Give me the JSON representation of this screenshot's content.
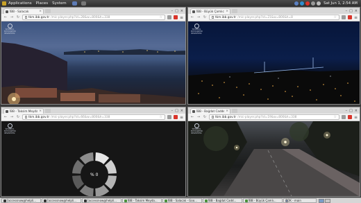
{
  "top_panel": {
    "menus": [
      "Applications",
      "Places",
      "System"
    ],
    "clock": "Sat Jun  1,  2:54 AM"
  },
  "windows": [
    {
      "tab_title": "İBB - Salacak",
      "url_host": "tkm.ibb.gov.tr",
      "url_path": "/mic-player.php?id=28&w=800&h=338"
    },
    {
      "tab_title": "İBB - Büyük Çamlıca",
      "url_host": "tkm.ibb.gov.tr",
      "url_path": "/mic-player.php?id=21&w=800&h=8"
    },
    {
      "tab_title": "İBB - Taksim Meydan...",
      "url_host": "tkm.ibb.gov.tr",
      "url_path": "/mic-player.php?id=66&w=800&h=338",
      "loading_text": "% 0",
      "loading_progress": 0
    },
    {
      "tab_title": "İBB - Bağdat Caddesi",
      "url_host": "tkm.ibb.gov.tr",
      "url_path": "/mic-player.php?id=19&w=800&h=338"
    }
  ],
  "logo_text": [
    "İSTANBUL",
    "BÜYÜKŞEHİR",
    "BELEDİYESİ"
  ],
  "taskbar": [
    {
      "label": "[accessnow@helpli...",
      "icon": "terminal-icon"
    },
    {
      "label": "[accessnow@helpli...",
      "icon": "terminal-icon"
    },
    {
      "label": "[accessnow@helpli...",
      "icon": "terminal-icon"
    },
    {
      "label": "İBB - Taksim Meyda...",
      "icon": "chrome-icon"
    },
    {
      "label": "İBB - Salacak - Goo...",
      "icon": "chrome-icon"
    },
    {
      "label": "İBB - Bağdat Cadd...",
      "icon": "chrome-icon"
    },
    {
      "label": "İBB - Büyük Çamlı...",
      "icon": "chrome-icon"
    },
    {
      "label": "OOK - main",
      "icon": "window-icon"
    }
  ],
  "icons": {
    "back": "back-arrow-icon",
    "forward": "forward-arrow-icon",
    "reload": "reload-icon",
    "star": "bookmark-star-icon",
    "menu": "chrome-menu-icon"
  },
  "colors": {
    "panel": "#3a3a3a",
    "ext_red": "#d9342b",
    "spinner_light": "#e6e6e6",
    "spinner_dark": "#5a5a5a"
  }
}
